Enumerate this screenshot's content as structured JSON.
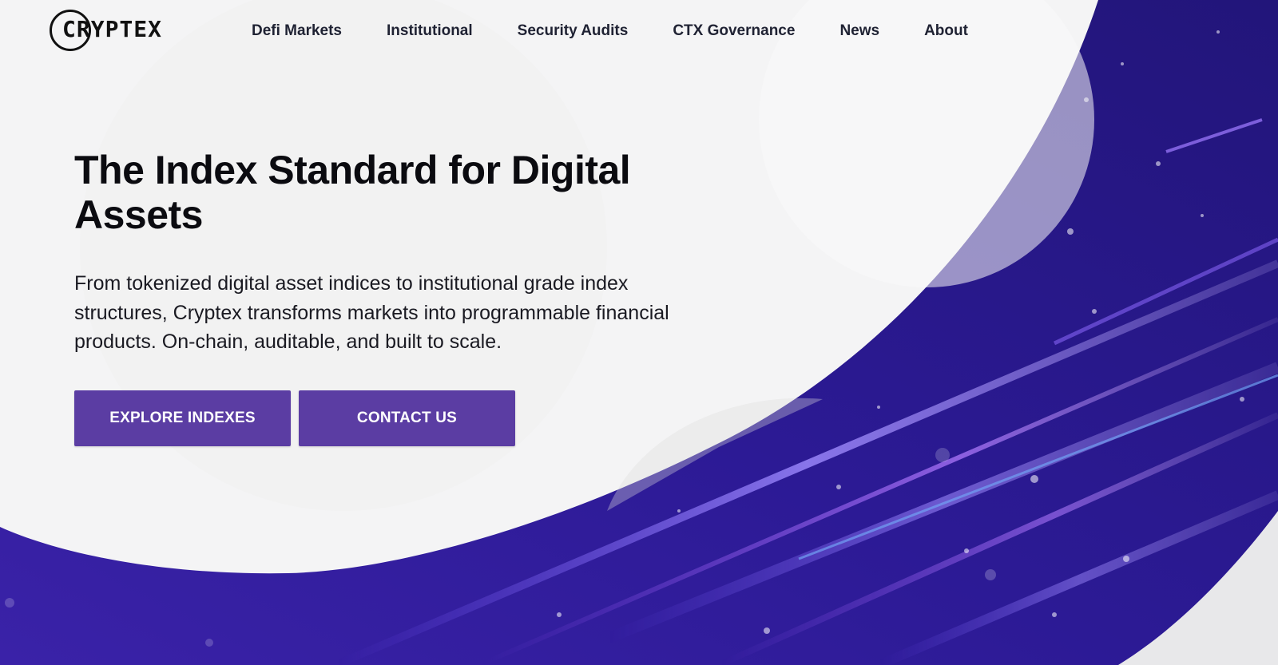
{
  "brand": {
    "logo_text": "CRYPTEX"
  },
  "nav": {
    "items": [
      {
        "label": "Defi Markets"
      },
      {
        "label": "Institutional"
      },
      {
        "label": "Security Audits"
      },
      {
        "label": "CTX Governance"
      },
      {
        "label": "News"
      },
      {
        "label": "About"
      }
    ]
  },
  "hero": {
    "title": "The Index Standard for Digital Assets",
    "description": "From tokenized digital asset indices to institutional grade index structures, Cryptex transforms markets into programmable financial products. On-chain, auditable, and built to scale.",
    "primary_button": "EXPLORE INDEXES",
    "secondary_button": "CONTACT US"
  },
  "colors": {
    "accent": "#5b3da3",
    "background_light": "#f4f4f5",
    "background_art": "#2a1b8f",
    "text_dark": "#0b0b10"
  }
}
